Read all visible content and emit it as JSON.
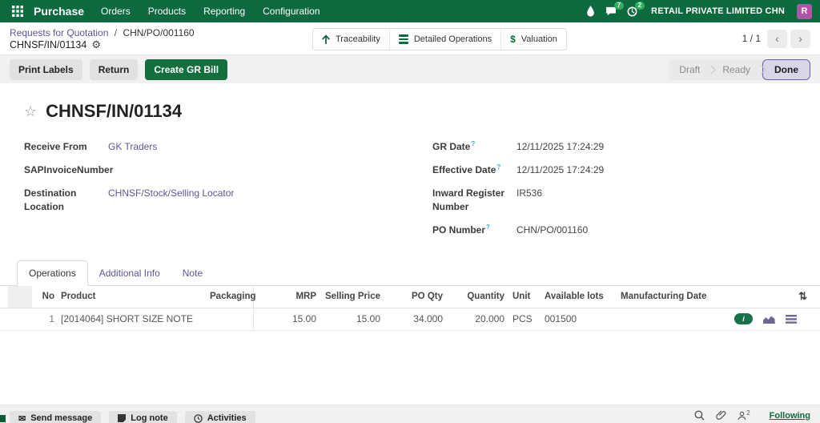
{
  "colors": {
    "brand_green": "#0d6a3f",
    "badge_green": "#31ae5f",
    "link_purple": "#5a5799",
    "help_blue": "#4aa3df",
    "avatar_magenta": "#b253a5",
    "primary_button_green": "#136f3e",
    "done_step_bg": "#dbd5e9",
    "done_step_border": "#70619e",
    "chatter_underline_green": "#0b5a33"
  },
  "icons": {
    "gear": "⚙",
    "star": "☆",
    "dollar": "$",
    "prev": "‹",
    "next": "›",
    "opt_columns": "⇅",
    "info": "i",
    "envelope": "✉"
  },
  "topbar": {
    "app_name": "Purchase",
    "menus": [
      "Orders",
      "Products",
      "Reporting",
      "Configuration"
    ],
    "messages_badge": "7",
    "activities_badge": "2",
    "company_name": "RETAIL PRIVATE LIMITED CHN",
    "user_avatar_initial": "R"
  },
  "breadcrumb": {
    "level1": "Requests for Quotation",
    "separator": "/",
    "level2": "CHN/PO/001160",
    "current": "CHNSF/IN/01134"
  },
  "smart_buttons": {
    "traceability": "Traceability",
    "detailed_operations": "Detailed Operations",
    "valuation": "Valuation"
  },
  "pager": {
    "text": "1 / 1"
  },
  "actions": {
    "print_labels": "Print Labels",
    "return_label": "Return",
    "create_gr_bill": "Create GR Bill"
  },
  "statusbar": {
    "steps": [
      "Draft",
      "Ready",
      "Done"
    ],
    "active": "Done"
  },
  "form": {
    "title": "CHNSF/IN/01134",
    "left_fields": [
      {
        "label": "Receive From",
        "value": "GK Traders"
      },
      {
        "label": "SAPInvoiceNumber",
        "value": ""
      },
      {
        "label": "Destination Location",
        "value": "CHNSF/Stock/Selling Locator"
      }
    ],
    "right_fields": [
      {
        "label": "GR Date",
        "help": "?",
        "value": "12/11/2025 17:24:29"
      },
      {
        "label": "Effective Date",
        "help": "?",
        "value": "12/11/2025 17:24:29"
      },
      {
        "label": "Inward Register Number",
        "help": "",
        "value": "IR536"
      },
      {
        "label": "PO Number",
        "help": "?",
        "value": "CHN/PO/001160"
      }
    ]
  },
  "tabs": {
    "items": [
      "Operations",
      "Additional Info",
      "Note"
    ],
    "active": "Operations"
  },
  "table": {
    "headers": [
      "No",
      "Product",
      "Packaging",
      "MRP",
      "Selling Price",
      "PO Qty",
      "Quantity",
      "Unit",
      "Available lots",
      "Manufacturing Date"
    ],
    "rows": [
      {
        "no": "1",
        "product": "[2014064] SHORT SIZE NOTE",
        "packaging": "",
        "mrp": "15.00",
        "selling_price": "15.00",
        "po_qty": "34.000",
        "quantity": "20.000",
        "unit": "PCS",
        "available_lots": "001500",
        "manufacturing_date": ""
      }
    ]
  },
  "chatter": {
    "send_message": "Send message",
    "log_note": "Log note",
    "activities": "Activities",
    "followers_count": "2",
    "following": "Following"
  }
}
